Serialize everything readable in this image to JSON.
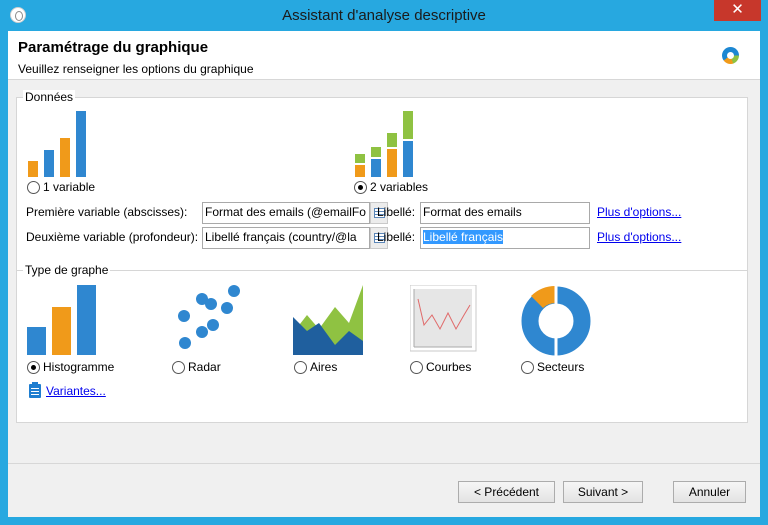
{
  "window": {
    "title": "Assistant d'analyse descriptive",
    "close_glyph": "✕"
  },
  "header": {
    "title": "Paramétrage du graphique",
    "subtitle": "Veuillez renseigner les options du graphique"
  },
  "data_group": {
    "legend": "Données",
    "option_1_label": "1 variable",
    "option_2_label": "2 variables",
    "selected_option": "2 variables",
    "first_variable": {
      "label": "Première variable (abscisses):",
      "value": "Format des emails (@emailFo",
      "libelle_label": "Libellé:",
      "libelle_value": "Format des emails",
      "more_link": "Plus d'options..."
    },
    "second_variable": {
      "label": "Deuxième variable (profondeur):",
      "value": "Libellé français (country/@la",
      "libelle_label": "Libellé:",
      "libelle_value": "Libellé français",
      "more_link": "Plus d'options..."
    }
  },
  "type_group": {
    "legend": "Type de graphe",
    "types": [
      {
        "label": "Histogramme",
        "selected": true,
        "icon": "histogram-icon"
      },
      {
        "label": "Radar",
        "selected": false,
        "icon": "radar-icon"
      },
      {
        "label": "Aires",
        "selected": false,
        "icon": "area-chart-icon"
      },
      {
        "label": "Courbes",
        "selected": false,
        "icon": "line-chart-icon"
      },
      {
        "label": "Secteurs",
        "selected": false,
        "icon": "pie-chart-icon"
      }
    ],
    "variants_link": "Variantes..."
  },
  "footer": {
    "previous_label": "< Précédent",
    "next_label": "Suivant >",
    "cancel_label": "Annuler"
  },
  "colors": {
    "orange": "#f09a1a",
    "blue": "#2f87d0",
    "green": "#8fc242",
    "dark_blue": "#1f5f9e",
    "titlebar": "#27a8e0",
    "close": "#c7372b"
  }
}
